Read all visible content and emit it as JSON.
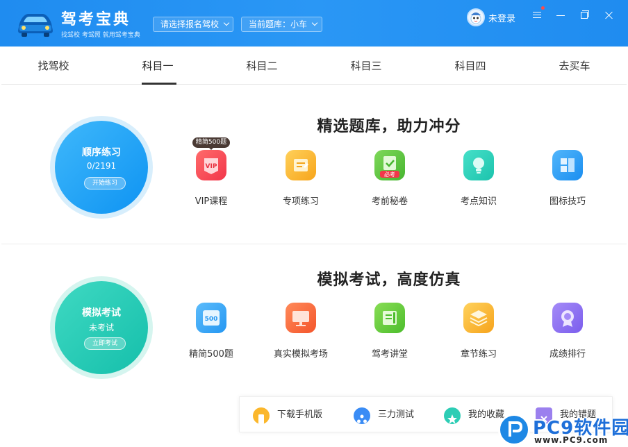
{
  "header": {
    "app_title": "驾考宝典",
    "slogan": "找驾校 考驾照 就用驾考宝典",
    "school_select": "请选择报名驾校",
    "bank_select": "当前题库：小车",
    "login": "未登录"
  },
  "tabs": [
    {
      "label": "找驾校"
    },
    {
      "label": "科目一",
      "active": true
    },
    {
      "label": "科目二"
    },
    {
      "label": "科目三"
    },
    {
      "label": "科目四"
    },
    {
      "label": "去买车"
    }
  ],
  "practice": {
    "title": "精选题库，助力冲分",
    "circle_title": "顺序练习",
    "progress": "0/2191",
    "circle_button": "开始练习",
    "badge": "精简500题",
    "features": [
      {
        "label": "VIP课程",
        "icon": "vip-course-icon",
        "color": "#f24d5a"
      },
      {
        "label": "专项练习",
        "icon": "special-practice-icon",
        "color": "#fbb72c"
      },
      {
        "label": "考前秘卷",
        "icon": "secret-paper-icon",
        "color": "#5fc843",
        "tag": "必考"
      },
      {
        "label": "考点知识",
        "icon": "knowledge-bulb-icon",
        "color": "#2dcdb5"
      },
      {
        "label": "图标技巧",
        "icon": "sign-tips-icon",
        "color": "#2b9cf0"
      }
    ]
  },
  "exam": {
    "title": "模拟考试，高度仿真",
    "circle_title": "模拟考试",
    "status": "未考试",
    "circle_button": "立即考试",
    "features": [
      {
        "label": "精简500题",
        "icon": "500-questions-icon",
        "color": "#3aa9f6",
        "inner": "500"
      },
      {
        "label": "真实模拟考场",
        "icon": "exam-room-monitor-icon",
        "color": "#fb6b3c"
      },
      {
        "label": "驾考讲堂",
        "icon": "lecture-hall-icon",
        "color": "#6bcf3e"
      },
      {
        "label": "章节练习",
        "icon": "chapter-stack-icon",
        "color": "#fbb42c"
      },
      {
        "label": "成绩排行",
        "icon": "ranking-medal-icon",
        "color": "#8e6ff2"
      }
    ]
  },
  "bottom_bar": [
    {
      "label": "下载手机版",
      "icon": "phone-download-icon",
      "color": "#fbb72c"
    },
    {
      "label": "三力测试",
      "icon": "ability-test-icon",
      "color": "#3a8cf5"
    },
    {
      "label": "我的收藏",
      "icon": "star-favorite-icon",
      "color": "#2dcdb5"
    },
    {
      "label": "我的错题",
      "icon": "wrong-question-icon",
      "color": "#9b80ee"
    }
  ],
  "watermark": {
    "text": "PC9软件园",
    "url": "www.PC9.com"
  }
}
